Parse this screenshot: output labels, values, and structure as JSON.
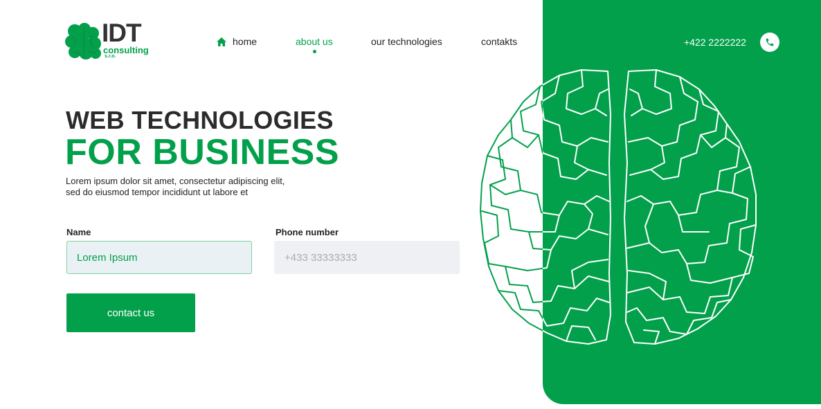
{
  "brand": {
    "logo_text": "IDT",
    "logo_sub": "consulting",
    "logo_sub2": "s.r.o."
  },
  "nav": {
    "items": [
      {
        "label": "home",
        "icon": "home-icon",
        "active": false
      },
      {
        "label": "about us",
        "active": true
      },
      {
        "label": "our technologies",
        "active": false
      },
      {
        "label": "contakts",
        "active": false
      }
    ]
  },
  "header": {
    "phone": "+422 2222222",
    "phone_icon": "phone-icon"
  },
  "hero": {
    "title_line1": "WEB TECHNOLOGIES",
    "title_line2": "FOR BUSINESS",
    "description_line1": "Lorem ipsum dolor sit amet, consectetur adipiscing elit,",
    "description_line2": "sed do eiusmod tempor incididunt ut labore et"
  },
  "form": {
    "name_label": "Name",
    "name_value": "Lorem Ipsum",
    "phone_label": "Phone number",
    "phone_placeholder": "+433 33333333",
    "submit_label": "contact us"
  },
  "colors": {
    "accent": "#03a04b",
    "text_dark": "#2b2b2b",
    "input_bg": "#eef0f4"
  }
}
